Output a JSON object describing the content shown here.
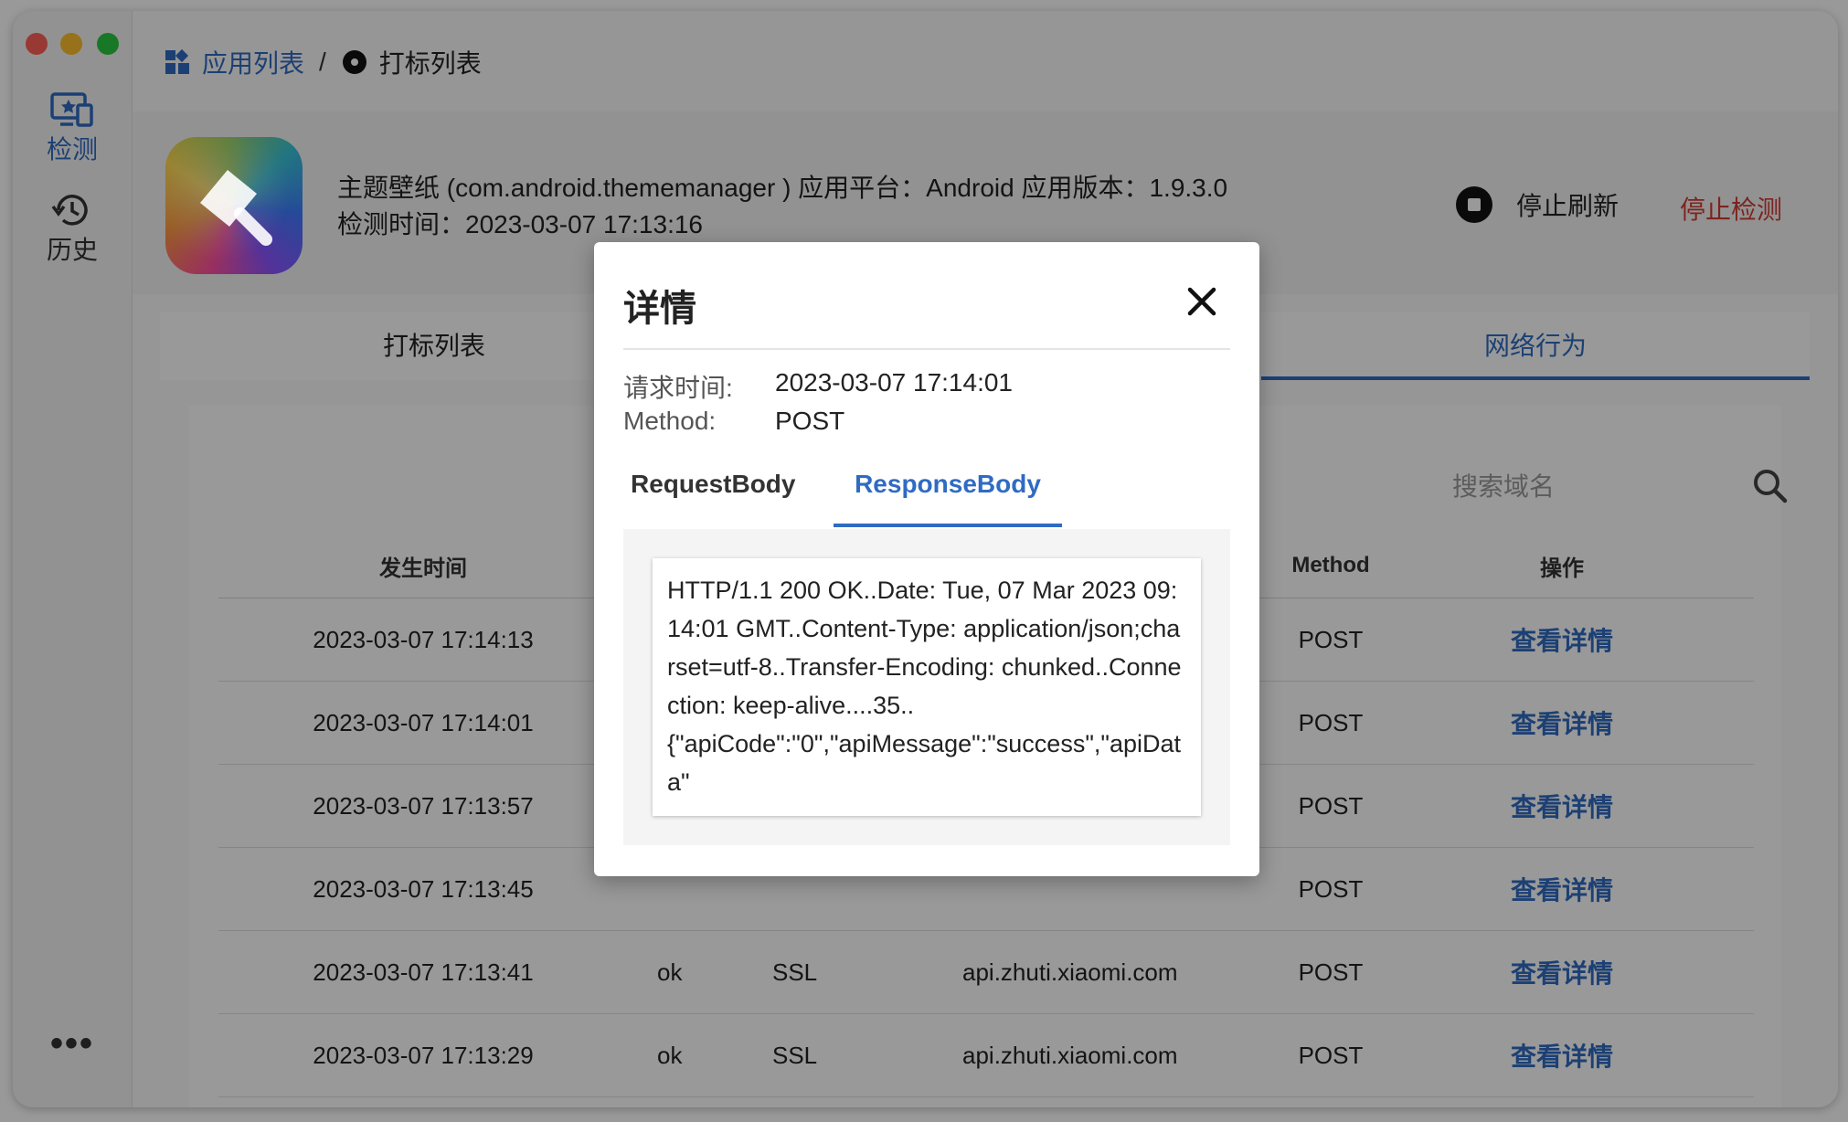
{
  "sidebar": {
    "detect_label": "检测",
    "history_label": "历史",
    "more_label": "•••"
  },
  "breadcrumb": {
    "app_list": "应用列表",
    "separator": "/",
    "current": "打标列表"
  },
  "app": {
    "info_line1": "主题壁纸 (com.android.thememanager ) 应用平台：Android 应用版本：1.9.3.0",
    "info_line2": "检测时间：2023-03-07 17:13:16",
    "stop_refresh": "停止刷新",
    "stop_detect": "停止检测"
  },
  "tabs": {
    "mark_list": "打标列表",
    "network": "网络行为"
  },
  "search": {
    "placeholder": "搜索域名"
  },
  "table": {
    "headers": {
      "time": "发生时间",
      "method": "Method",
      "action": "操作"
    },
    "rows": [
      {
        "time": "2023-03-07 17:14:13",
        "status": "",
        "protocol": "",
        "host": "",
        "method": "POST",
        "action": "查看详情"
      },
      {
        "time": "2023-03-07 17:14:01",
        "status": "",
        "protocol": "",
        "host": "",
        "method": "POST",
        "action": "查看详情"
      },
      {
        "time": "2023-03-07 17:13:57",
        "status": "",
        "protocol": "",
        "host": "",
        "method": "POST",
        "action": "查看详情"
      },
      {
        "time": "2023-03-07 17:13:45",
        "status": "",
        "protocol": "",
        "host": "",
        "method": "POST",
        "action": "查看详情"
      },
      {
        "time": "2023-03-07 17:13:41",
        "status": "ok",
        "protocol": "SSL",
        "host": "api.zhuti.xiaomi.com",
        "method": "POST",
        "action": "查看详情"
      },
      {
        "time": "2023-03-07 17:13:29",
        "status": "ok",
        "protocol": "SSL",
        "host": "api.zhuti.xiaomi.com",
        "method": "POST",
        "action": "查看详情"
      }
    ]
  },
  "dialog": {
    "title": "详情",
    "request_time_label": "请求时间:",
    "request_time_value": "2023-03-07 17:14:01",
    "method_label": "Method:",
    "method_value": "POST",
    "tab_request": "RequestBody",
    "tab_response": "ResponseBody",
    "response_body": "HTTP/1.1 200 OK..Date: Tue, 07 Mar 2023 09:14:01 GMT..Content-Type: application/json;charset=utf-8..Transfer-Encoding: chunked..Connection: keep-alive....35..\n{\"apiCode\":\"0\",\"apiMessage\":\"success\",\"apiData\""
  },
  "colors": {
    "accent": "#2f6bc2",
    "danger": "#d03b32",
    "overlay": "rgba(0,0,0,0.40)"
  }
}
